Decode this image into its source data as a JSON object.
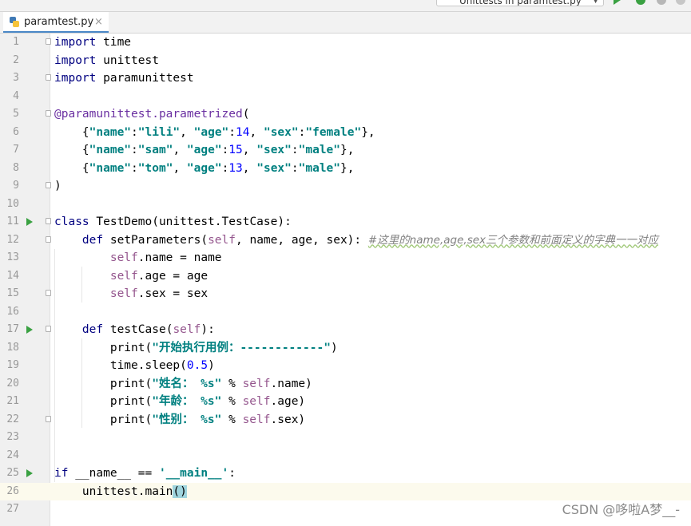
{
  "toolbar": {
    "run_config_label": "Unittests in paramtest.py"
  },
  "tab": {
    "filename": "paramtest.py",
    "close_glyph": "×"
  },
  "colors": {
    "keyword": "#000080",
    "string": "#008080",
    "number": "#0000ff",
    "self": "#94558d",
    "comment": "#808080",
    "run_marker": "#3aa142"
  },
  "editor": {
    "current_line": 26,
    "lines": [
      {
        "n": "1",
        "tokens": [
          {
            "t": "import",
            "c": "kw"
          },
          {
            "t": " time"
          }
        ]
      },
      {
        "n": "2",
        "tokens": [
          {
            "t": "import",
            "c": "kw"
          },
          {
            "t": " unittest"
          }
        ]
      },
      {
        "n": "3",
        "tokens": [
          {
            "t": "import",
            "c": "kw"
          },
          {
            "t": " paramunittest"
          }
        ]
      },
      {
        "n": "4",
        "tokens": []
      },
      {
        "n": "5",
        "tokens": [
          {
            "t": "@paramunittest.parametrized",
            "c": "dec"
          },
          {
            "t": "("
          }
        ]
      },
      {
        "n": "6",
        "tokens": [
          {
            "t": "    {"
          },
          {
            "t": "\"name\"",
            "c": "str"
          },
          {
            "t": ":"
          },
          {
            "t": "\"lili\"",
            "c": "str"
          },
          {
            "t": ", "
          },
          {
            "t": "\"age\"",
            "c": "str"
          },
          {
            "t": ":"
          },
          {
            "t": "14",
            "c": "num"
          },
          {
            "t": ", "
          },
          {
            "t": "\"sex\"",
            "c": "str"
          },
          {
            "t": ":"
          },
          {
            "t": "\"female\"",
            "c": "str"
          },
          {
            "t": "},"
          }
        ]
      },
      {
        "n": "7",
        "tokens": [
          {
            "t": "    {"
          },
          {
            "t": "\"name\"",
            "c": "str"
          },
          {
            "t": ":"
          },
          {
            "t": "\"sam\"",
            "c": "str"
          },
          {
            "t": ", "
          },
          {
            "t": "\"age\"",
            "c": "str"
          },
          {
            "t": ":"
          },
          {
            "t": "15",
            "c": "num"
          },
          {
            "t": ", "
          },
          {
            "t": "\"sex\"",
            "c": "str"
          },
          {
            "t": ":"
          },
          {
            "t": "\"male\"",
            "c": "str"
          },
          {
            "t": "},"
          }
        ]
      },
      {
        "n": "8",
        "tokens": [
          {
            "t": "    {"
          },
          {
            "t": "\"name\"",
            "c": "str"
          },
          {
            "t": ":"
          },
          {
            "t": "\"tom\"",
            "c": "str"
          },
          {
            "t": ", "
          },
          {
            "t": "\"age\"",
            "c": "str"
          },
          {
            "t": ":"
          },
          {
            "t": "13",
            "c": "num"
          },
          {
            "t": ", "
          },
          {
            "t": "\"sex\"",
            "c": "str"
          },
          {
            "t": ":"
          },
          {
            "t": "\"male\"",
            "c": "str"
          },
          {
            "t": "},"
          }
        ]
      },
      {
        "n": "9",
        "tokens": [
          {
            "t": ")"
          }
        ]
      },
      {
        "n": "10",
        "tokens": []
      },
      {
        "n": "11",
        "tokens": [
          {
            "t": "class",
            "c": "kw"
          },
          {
            "t": " TestDemo(unittest.TestCase):"
          }
        ],
        "run": true
      },
      {
        "n": "12",
        "tokens": [
          {
            "t": "    "
          },
          {
            "t": "def",
            "c": "kw"
          },
          {
            "t": " setParameters("
          },
          {
            "t": "self",
            "c": "self"
          },
          {
            "t": ", name, age, sex): "
          },
          {
            "t": "#这里的name,age,sex三个参数和前面定义的字典一一对应",
            "c": "cmt"
          }
        ]
      },
      {
        "n": "13",
        "tokens": [
          {
            "t": "        "
          },
          {
            "t": "self",
            "c": "self"
          },
          {
            "t": ".name = name"
          }
        ]
      },
      {
        "n": "14",
        "tokens": [
          {
            "t": "        "
          },
          {
            "t": "self",
            "c": "self"
          },
          {
            "t": ".age = age"
          }
        ]
      },
      {
        "n": "15",
        "tokens": [
          {
            "t": "        "
          },
          {
            "t": "self",
            "c": "self"
          },
          {
            "t": ".sex = sex"
          }
        ]
      },
      {
        "n": "16",
        "tokens": []
      },
      {
        "n": "17",
        "tokens": [
          {
            "t": "    "
          },
          {
            "t": "def",
            "c": "kw"
          },
          {
            "t": " testCase("
          },
          {
            "t": "self",
            "c": "self"
          },
          {
            "t": "):"
          }
        ],
        "run": true
      },
      {
        "n": "18",
        "tokens": [
          {
            "t": "        print("
          },
          {
            "t": "\"开始执行用例：------------\"",
            "c": "str"
          },
          {
            "t": ")"
          }
        ]
      },
      {
        "n": "19",
        "tokens": [
          {
            "t": "        time.sleep("
          },
          {
            "t": "0.5",
            "c": "num"
          },
          {
            "t": ")"
          }
        ]
      },
      {
        "n": "20",
        "tokens": [
          {
            "t": "        print("
          },
          {
            "t": "\"姓名： %s\"",
            "c": "str"
          },
          {
            "t": " % "
          },
          {
            "t": "self",
            "c": "self"
          },
          {
            "t": ".name)"
          }
        ]
      },
      {
        "n": "21",
        "tokens": [
          {
            "t": "        print("
          },
          {
            "t": "\"年龄： %s\"",
            "c": "str"
          },
          {
            "t": " % "
          },
          {
            "t": "self",
            "c": "self"
          },
          {
            "t": ".age)"
          }
        ]
      },
      {
        "n": "22",
        "tokens": [
          {
            "t": "        print("
          },
          {
            "t": "\"性别： %s\"",
            "c": "str"
          },
          {
            "t": " % "
          },
          {
            "t": "self",
            "c": "self"
          },
          {
            "t": ".sex)"
          }
        ]
      },
      {
        "n": "23",
        "tokens": []
      },
      {
        "n": "24",
        "tokens": []
      },
      {
        "n": "25",
        "tokens": [
          {
            "t": "if",
            "c": "kw"
          },
          {
            "t": " __name__ == "
          },
          {
            "t": "'__main__'",
            "c": "str"
          },
          {
            "t": ":"
          }
        ],
        "run": true
      },
      {
        "n": "26",
        "tokens": [
          {
            "t": "    unittest.main"
          },
          {
            "t": "()",
            "c": "bm"
          }
        ]
      },
      {
        "n": "27",
        "tokens": []
      }
    ]
  },
  "watermark": "CSDN @哆啦A梦__-"
}
